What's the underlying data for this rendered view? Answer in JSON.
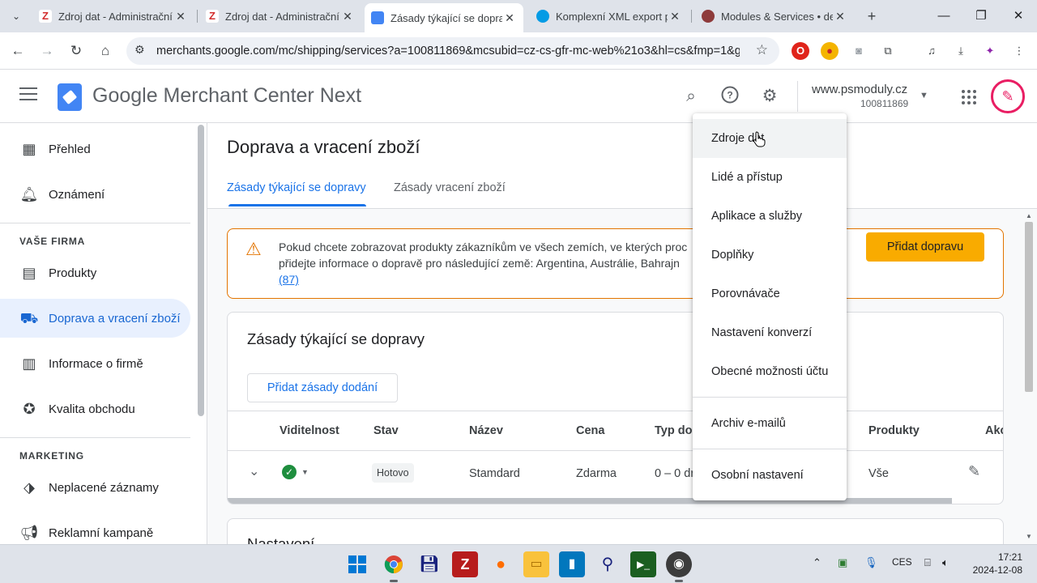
{
  "browser": {
    "tabs": [
      {
        "title": "Zdroj dat - Administrační",
        "favicon_color": "#d32f2f",
        "active": false
      },
      {
        "title": "Zdroj dat - Administrační",
        "favicon_color": "#d32f2f",
        "active": false
      },
      {
        "title": "Zásady týkající se doprav",
        "favicon_color": "#4285f4",
        "active": true
      },
      {
        "title": "Komplexní XML export p",
        "favicon_color": "#039be5",
        "active": false
      },
      {
        "title": "Modules & Services • de",
        "favicon_color": "#8e3b3b",
        "active": false
      }
    ],
    "url": "merchants.google.com/mc/shipping/services?a=100811869&mcsubid=cz-cs-gfr-mc-web%21o3&hl=cs&fmp=1&g..."
  },
  "header": {
    "product_name": "Google Merchant Center Next",
    "account_name": "www.psmoduly.cz",
    "account_id": "100811869"
  },
  "sidebar": {
    "items": [
      {
        "label": "Přehled",
        "icon": "dashboard-icon"
      },
      {
        "label": "Oznámení",
        "icon": "bell-icon"
      },
      {
        "label": "Produkty",
        "icon": "archive-box-icon"
      },
      {
        "label": "Doprava a vracení zboží",
        "icon": "truck-icon"
      },
      {
        "label": "Informace o firmě",
        "icon": "building-icon"
      },
      {
        "label": "Kvalita obchodu",
        "icon": "badge-icon"
      },
      {
        "label": "Neplacené záznamy",
        "icon": "tag-icon"
      },
      {
        "label": "Reklamní kampaně",
        "icon": "megaphone-icon"
      }
    ],
    "sections": {
      "business": "VAŠE FIRMA",
      "marketing": "MARKETING"
    }
  },
  "main": {
    "page_title": "Doprava a vracení zboží",
    "tabs": [
      {
        "label": "Zásady týkající se dopravy"
      },
      {
        "label": "Zásady vracení zboží"
      }
    ],
    "warning": {
      "line1": "Pokud chcete zobrazovat produkty zákazníkům ve všech zemích, ve kterých proc",
      "line2": "přidejte informace o dopravě pro následující země: Argentina, Austrálie, Bahrajn",
      "link": "(87)",
      "button": "Přidat dopravu"
    },
    "policies_card": {
      "title": "Zásady týkající se dopravy",
      "add_button": "Přidat zásady dodání",
      "columns": [
        "Viditelnost",
        "Stav",
        "Název",
        "Cena",
        "Typ doc",
        "Produkty",
        "Akc"
      ],
      "rows": [
        {
          "status": "Hotovo",
          "name": "Stamdard",
          "price": "Zdarma",
          "delivery": "0 – 0 dr",
          "products": "Vše"
        }
      ]
    },
    "settings_card_title": "Nastavení"
  },
  "menu": {
    "items": [
      "Zdroje dat",
      "Lidé a přístup",
      "Aplikace a služby",
      "Doplňky",
      "Porovnávače",
      "Nastavení konverzí",
      "Obecné možnosti účtu",
      "Archiv e-mailů",
      "Osobní nastavení"
    ]
  },
  "taskbar": {
    "language": "CES",
    "time": "17:21",
    "date": "2024-12-08"
  },
  "colors": {
    "accent": "#1a73e8",
    "warning": "#e37400",
    "primary_button": "#f9ab00",
    "success": "#1e8e3e",
    "nav_active_bg": "#e8f0fe"
  }
}
